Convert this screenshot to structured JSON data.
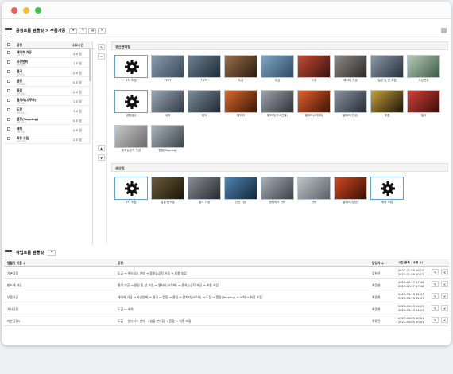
{
  "top_panel": {
    "title": "공정흐름 템플릿 > 부품가공",
    "buttons": [
      "▾",
      "✎",
      "▤",
      "✕"
    ]
  },
  "left_list": {
    "headers": {
      "name": "공정",
      "time": "소요시간"
    },
    "items": [
      {
        "name": "레이저 가공",
        "code": "OP-020",
        "time": "4.0 일"
      },
      {
        "name": "사상면취",
        "code": "OP-019",
        "time": "1.5 일"
      },
      {
        "name": "절곡",
        "code": "OP-021",
        "time": "2.0 일"
      },
      {
        "name": "탭핑",
        "code": "OP-022",
        "time": "0.5 일"
      },
      {
        "name": "용접",
        "code": "OP-023",
        "time": "2.0 일"
      },
      {
        "name": "열처리(고주파)",
        "code": "OP-012",
        "time": "1.0 일"
      },
      {
        "name": "도장",
        "code": "OP-025",
        "time": "3.0 일"
      },
      {
        "name": "탭핑(Tapping)",
        "code": "OP-026",
        "time": "0.5 일"
      },
      {
        "name": "세척",
        "code": "OP-027",
        "time": "0.5 일"
      },
      {
        "name": "최종 조립",
        "code": "OP-030",
        "time": "2.0 일"
      }
    ]
  },
  "mid_buttons": [
    "✎",
    "−",
    "▲",
    "▼"
  ],
  "library": {
    "title": "생산관리팀",
    "tiles": [
      {
        "label": "1차 조립",
        "kind": "gear"
      },
      {
        "label": "TEST",
        "kind": "img",
        "colors": [
          "#8a9ab0",
          "#3a4a5a"
        ]
      },
      {
        "label": "TST3",
        "kind": "img",
        "colors": [
          "#6f8090",
          "#1e2a36"
        ]
      },
      {
        "label": "도금",
        "kind": "img",
        "colors": [
          "#9a6f4a",
          "#2a1a10"
        ]
      },
      {
        "label": "도금",
        "kind": "img",
        "colors": [
          "#7fa6c4",
          "#2f4a66"
        ]
      },
      {
        "label": "도장",
        "kind": "img",
        "colors": [
          "#c44b32",
          "#3a1210"
        ]
      },
      {
        "label": "레이저 가공",
        "kind": "img",
        "colors": [
          "#8e8a86",
          "#2c2a28"
        ]
      },
      {
        "label": "밀링 및 선 조립",
        "kind": "img",
        "colors": [
          "#8b98a6",
          "#27313c"
        ]
      },
      {
        "label": "사상면취",
        "kind": "img",
        "colors": [
          "#b6cbb8",
          "#3d5a44"
        ]
      },
      {
        "label": "생활검사",
        "kind": "gear"
      },
      {
        "label": "세척",
        "kind": "img",
        "colors": [
          "#9aa7b4",
          "#313b46"
        ]
      },
      {
        "label": "절곡",
        "kind": "img",
        "colors": [
          "#7e8c98",
          "#1f2a33"
        ]
      },
      {
        "label": "열처리",
        "kind": "img",
        "colors": [
          "#d86a2a",
          "#3b1608"
        ]
      },
      {
        "label": "열처리(가스연질)",
        "kind": "img",
        "colors": [
          "#a0a4a8",
          "#2e3236"
        ]
      },
      {
        "label": "열처리(고주파)",
        "kind": "img",
        "colors": [
          "#e0602c",
          "#401404"
        ]
      },
      {
        "label": "열처리(진공)",
        "kind": "img",
        "colors": [
          "#8a94a0",
          "#232b34"
        ]
      },
      {
        "label": "용접",
        "kind": "img",
        "colors": [
          "#c6a03c",
          "#1c1608"
        ]
      },
      {
        "label": "절삭",
        "kind": "img",
        "colors": [
          "#d2423a",
          "#3a0c0a"
        ]
      },
      {
        "label": "중처능공작 가공",
        "kind": "img",
        "colors": [
          "#c8c8c8",
          "#6a6a6a"
        ]
      },
      {
        "label": "탭핑(Tapping)",
        "kind": "img",
        "colors": [
          "#aab2ba",
          "#3c444c"
        ]
      }
    ]
  },
  "flow": {
    "title": "생산팀",
    "tiles": [
      {
        "label": "2차 조립",
        "kind": "gear"
      },
      {
        "label": "입출·판드참",
        "kind": "img",
        "colors": [
          "#6a5a3a",
          "#1a1608"
        ]
      },
      {
        "label": "절삭 가공",
        "kind": "img",
        "colors": [
          "#8a8e92",
          "#26292c"
        ]
      },
      {
        "label": "선반 가공",
        "kind": "img",
        "colors": [
          "#4e86b0",
          "#12263a"
        ]
      },
      {
        "label": "센터리스 연마",
        "kind": "img",
        "colors": [
          "#a8b0b6",
          "#3a4248"
        ]
      },
      {
        "label": "연마",
        "kind": "img",
        "colors": [
          "#c0c4c8",
          "#5a6066"
        ]
      },
      {
        "label": "열처리(침탄)",
        "kind": "img",
        "colors": [
          "#d04a22",
          "#3a0e04"
        ]
      },
      {
        "label": "최종 조립",
        "kind": "gear"
      }
    ]
  },
  "bottom_panel": {
    "title": "작업흐름 템플릿",
    "buttons": [
      "▾"
    ],
    "headers": {
      "name": "템플릿 이름 ≑",
      "process": "공정",
      "owner": "담당자 ≑",
      "time": "시간(등록 / 수정 ≑)"
    },
    "rows": [
      {
        "name": "기본공정",
        "process": "도금 → 센터리스 연마 → 중처능공작 가공 → 최종 조립",
        "owner": "김현선",
        "created": "2023-01-09 10:12",
        "updated": "2023-01-09 10:12"
      },
      {
        "name": "판드체 가공",
        "process": "절삭 가공 → 밀링 및 선 조립 → 열처리(고주파) → 중처능공작 가공 → 최종 조립",
        "owner": "최명관",
        "created": "2023-02-17 17:46",
        "updated": "2023-02-17 17:46"
      },
      {
        "name": "부품가공",
        "process": "레이저 가공 → 사상면취 → 절곡 → 탭핑 → 용접 → 열처리(고주파) → 도장 → 탭핑(Tapping) → 세척 → 최종 조립",
        "owner": "최명관",
        "created": "2023-03-13 12:47",
        "updated": "2023-03-13 12:47"
      },
      {
        "name": "기타공정",
        "process": "도금 → 세척",
        "owner": "최명관",
        "created": "2023-03-13 14:09",
        "updated": "2023-03-13 14:09"
      },
      {
        "name": "기본공정2",
        "process": "도금 → 센터리스 연마 → 입출·판드참 → 용접 → 최종 조립",
        "owner": "최명관",
        "created": "2023-04-05 10:01",
        "updated": "2023-04-05 10:01"
      }
    ],
    "action_icons": [
      "✎",
      "✕"
    ]
  }
}
